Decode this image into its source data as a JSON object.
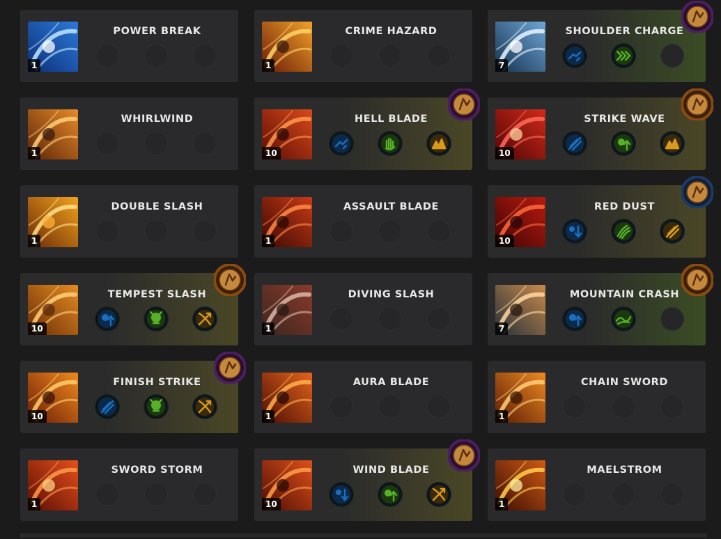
{
  "colors": {
    "page_bg": "#1b1b1c",
    "card_bg": "#2a2a2c",
    "tier_yellow": "#4a4726",
    "tier_green": "#3b4d24",
    "rune_purple": "#4c1f60",
    "rune_orange": "#8a4b12",
    "rune_blue": "#1f3a63"
  },
  "skills": [
    {
      "name": "POWER BREAK",
      "level": "1",
      "art": "blue-burst",
      "tier": "none",
      "rune": null,
      "tripods": [
        null,
        null,
        null
      ]
    },
    {
      "name": "CRIME HAZARD",
      "level": "1",
      "art": "fire-slash",
      "tier": "none",
      "rune": null,
      "tripods": [
        null,
        null,
        null
      ]
    },
    {
      "name": "SHOULDER CHARGE",
      "level": "7",
      "art": "charge-blue",
      "tier": "green",
      "rune": "purple",
      "tripods": [
        "blue-dash",
        "green-arrows",
        null
      ]
    },
    {
      "name": "WHIRLWIND",
      "level": "1",
      "art": "whirl-orange",
      "tier": "none",
      "rune": null,
      "tripods": [
        null,
        null,
        null
      ]
    },
    {
      "name": "HELL BLADE",
      "level": "10",
      "art": "hell-sword",
      "tier": "yellow",
      "rune": "purple",
      "tripods": [
        "blue-dash",
        "green-hand",
        "gold-peaks"
      ]
    },
    {
      "name": "STRIKE WAVE",
      "level": "10",
      "art": "red-burst",
      "tier": "yellow",
      "rune": "orange",
      "tripods": [
        "blue-slash",
        "green-up",
        "gold-peaks"
      ]
    },
    {
      "name": "DOUBLE SLASH",
      "level": "1",
      "art": "gold-swirl",
      "tier": "none",
      "rune": null,
      "tripods": [
        null,
        null,
        null
      ]
    },
    {
      "name": "ASSAULT BLADE",
      "level": "1",
      "art": "red-swirl",
      "tier": "none",
      "rune": null,
      "tripods": [
        null,
        null,
        null
      ]
    },
    {
      "name": "RED DUST",
      "level": "10",
      "art": "red-vortex",
      "tier": "yellow",
      "rune": "blue",
      "tripods": [
        "blue-down",
        "green-claw",
        "gold-slash"
      ]
    },
    {
      "name": "TEMPEST SLASH",
      "level": "10",
      "art": "tempest",
      "tier": "yellow",
      "rune": "orange",
      "tripods": [
        "blue-up",
        "green-skull",
        "gold-cross"
      ]
    },
    {
      "name": "DIVING SLASH",
      "level": "1",
      "art": "dive",
      "tier": "none",
      "rune": null,
      "tripods": [
        null,
        null,
        null
      ]
    },
    {
      "name": "MOUNTAIN CRASH",
      "level": "7",
      "art": "mountain",
      "tier": "green",
      "rune": "orange",
      "tripods": [
        "blue-up",
        "green-wave",
        null
      ]
    },
    {
      "name": "FINISH STRIKE",
      "level": "10",
      "art": "finish",
      "tier": "yellow",
      "rune": "purple",
      "tripods": [
        "blue-slash",
        "green-skull",
        "gold-cross"
      ]
    },
    {
      "name": "AURA BLADE",
      "level": "1",
      "art": "aura",
      "tier": "none",
      "rune": null,
      "tripods": [
        null,
        null,
        null
      ]
    },
    {
      "name": "CHAIN SWORD",
      "level": "1",
      "art": "chain",
      "tier": "none",
      "rune": null,
      "tripods": [
        null,
        null,
        null
      ]
    },
    {
      "name": "SWORD STORM",
      "level": "1",
      "art": "storm",
      "tier": "none",
      "rune": null,
      "tripods": [
        null,
        null,
        null
      ]
    },
    {
      "name": "WIND BLADE",
      "level": "10",
      "art": "wind",
      "tier": "yellow",
      "rune": "purple",
      "tripods": [
        "blue-down",
        "green-up",
        "gold-cross"
      ]
    },
    {
      "name": "MAELSTROM",
      "level": "1",
      "art": "maelstrom",
      "tier": "none",
      "rune": null,
      "tripods": [
        null,
        null,
        null
      ]
    }
  ]
}
